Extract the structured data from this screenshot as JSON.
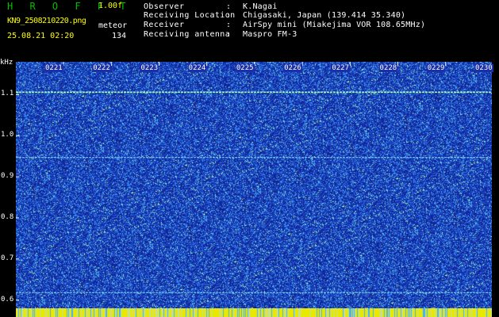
{
  "header": {
    "title": "H R O F F T",
    "version": "1.00f",
    "filename": "KN9_2508210220.png",
    "mode": "meteor",
    "datetime": "25.08.21 02:20",
    "count": "134"
  },
  "fields": [
    {
      "label": "Observer",
      "value": "K.Nagai"
    },
    {
      "label": "Receiving Location",
      "value": "Chigasaki, Japan (139.414 35.340)"
    },
    {
      "label": "Receiver",
      "value": "AirSpy mini (Miakejima VOR 108.65MHz)"
    },
    {
      "label": "Receiving antenna",
      "value": "Maspro FM-3"
    }
  ],
  "separator": ":",
  "chart_data": {
    "type": "heatmap",
    "y_unit": "kHz",
    "y_ticks": [
      "1.1",
      "1.0",
      "0.9",
      "0.8",
      "0.7",
      "0.6"
    ],
    "x_ticks": [
      "0221",
      "0222",
      "0223",
      "0224",
      "0225",
      "0226",
      "0227",
      "0228",
      "0229",
      "0230"
    ],
    "ylim": [
      0.58,
      1.18
    ],
    "carrier_lines_khz": [
      1.106,
      0.947,
      0.618
    ],
    "colors": {
      "background": "#1930a8",
      "noise": "#4fa8ff",
      "hot": "#ffff40",
      "bottom_bar": "#e8e800"
    }
  }
}
